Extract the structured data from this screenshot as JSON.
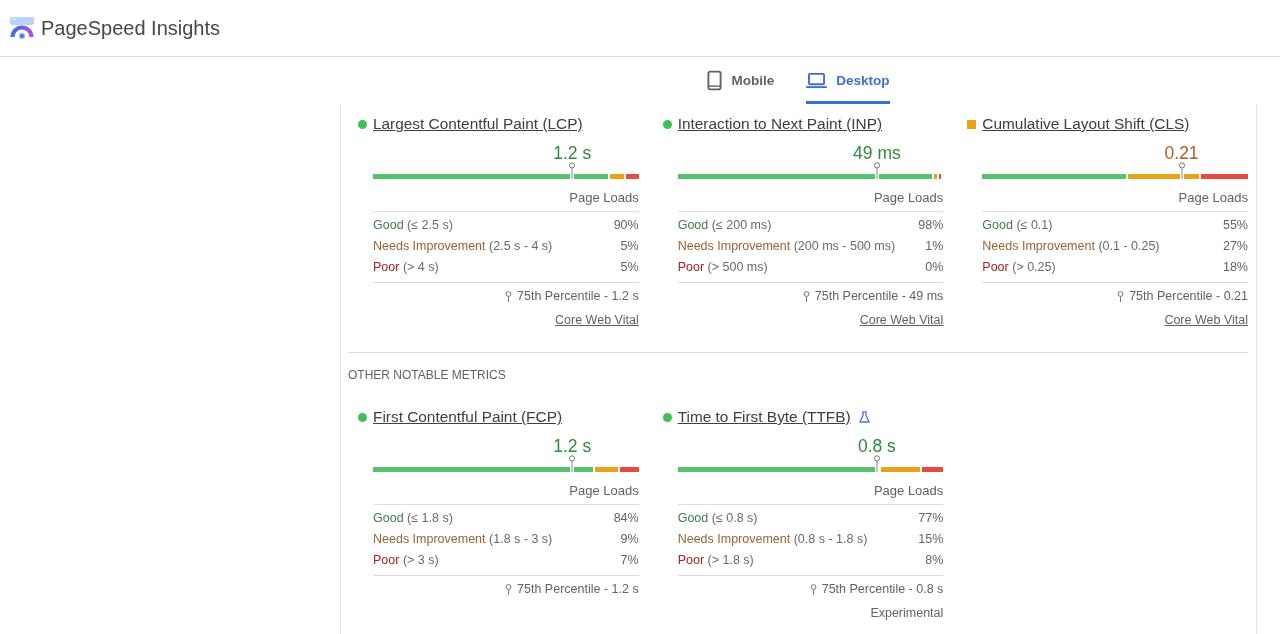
{
  "header": {
    "title": "PageSpeed Insights"
  },
  "tabs": [
    {
      "label": "Mobile",
      "kind": "mobile",
      "selected": false
    },
    {
      "label": "Desktop",
      "kind": "desktop",
      "selected": true
    }
  ],
  "sections": [
    {
      "cards": [
        {
          "name": "Largest Contentful Paint (LCP)",
          "kind": "good",
          "experimental": false,
          "value": "1.2 s",
          "scale_label": "Page Loads",
          "distribution": [
            {
              "kind": "good",
              "label": "Good",
              "range": "(≤ 2.5 s)",
              "share": "90%"
            },
            {
              "kind": "average",
              "label": "Needs Improvement",
              "range": "(2.5 s - 4 s)",
              "share": "5%"
            },
            {
              "kind": "poor",
              "label": "Poor",
              "range": "(> 4 s)",
              "share": "5%"
            }
          ],
          "percentile": "75th Percentile - 1.2 s",
          "footer": {
            "kind": "link",
            "text": "Core Web Vital"
          }
        },
        {
          "name": "Interaction to Next Paint (INP)",
          "kind": "good",
          "experimental": false,
          "value": "49 ms",
          "scale_label": "Page Loads",
          "distribution": [
            {
              "kind": "good",
              "label": "Good",
              "range": "(≤ 200 ms)",
              "share": "98%"
            },
            {
              "kind": "average",
              "label": "Needs Improvement",
              "range": "(200 ms - 500 ms)",
              "share": "1%"
            },
            {
              "kind": "poor",
              "label": "Poor",
              "range": "(> 500 ms)",
              "share": "0%"
            }
          ],
          "percentile": "75th Percentile - 49 ms",
          "footer": {
            "kind": "link",
            "text": "Core Web Vital"
          }
        },
        {
          "name": "Cumulative Layout Shift (CLS)",
          "kind": "average",
          "experimental": false,
          "value": "0.21",
          "scale_label": "Page Loads",
          "distribution": [
            {
              "kind": "good",
              "label": "Good",
              "range": "(≤ 0.1)",
              "share": "55%"
            },
            {
              "kind": "average",
              "label": "Needs Improvement",
              "range": "(0.1 - 0.25)",
              "share": "27%"
            },
            {
              "kind": "poor",
              "label": "Poor",
              "range": "(> 0.25)",
              "share": "18%"
            }
          ],
          "percentile": "75th Percentile - 0.21",
          "footer": {
            "kind": "link",
            "text": "Core Web Vital"
          }
        }
      ]
    },
    {
      "title": "OTHER NOTABLE METRICS",
      "cards": [
        {
          "name": "First Contentful Paint (FCP)",
          "kind": "good",
          "experimental": false,
          "value": "1.2 s",
          "scale_label": "Page Loads",
          "distribution": [
            {
              "kind": "good",
              "label": "Good",
              "range": "(≤ 1.8 s)",
              "share": "84%"
            },
            {
              "kind": "average",
              "label": "Needs Improvement",
              "range": "(1.8 s - 3 s)",
              "share": "9%"
            },
            {
              "kind": "poor",
              "label": "Poor",
              "range": "(> 3 s)",
              "share": "7%"
            }
          ],
          "percentile": "75th Percentile - 1.2 s"
        },
        {
          "name": "Time to First Byte (TTFB)",
          "kind": "good",
          "experimental": true,
          "value": "0.8 s",
          "scale_label": "Page Loads",
          "distribution": [
            {
              "kind": "good",
              "label": "Good",
              "range": "(≤ 0.8 s)",
              "share": "77%"
            },
            {
              "kind": "average",
              "label": "Needs Improvement",
              "range": "(0.8 s - 1.8 s)",
              "share": "15%"
            },
            {
              "kind": "poor",
              "label": "Poor",
              "range": "(> 1.8 s)",
              "share": "8%"
            }
          ],
          "percentile": "75th Percentile - 0.8 s",
          "footer": {
            "kind": "label",
            "text": "Experimental"
          }
        }
      ]
    }
  ]
}
